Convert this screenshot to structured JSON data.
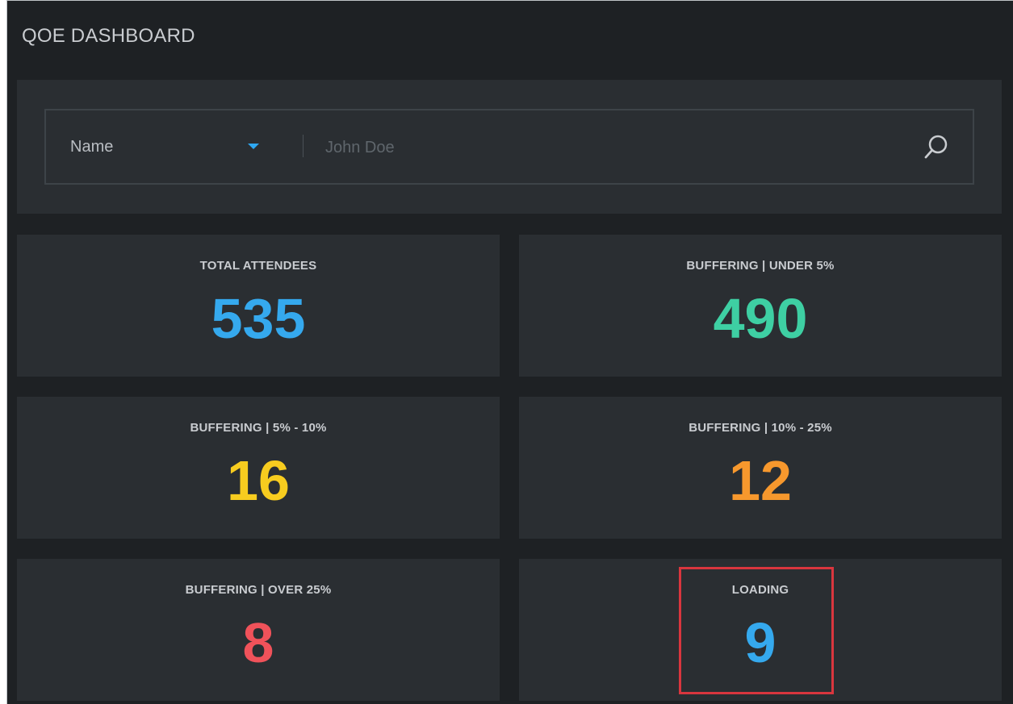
{
  "header": {
    "title": "QOE DASHBOARD"
  },
  "search": {
    "field_selected": "Name",
    "placeholder": "John Doe",
    "caret_color": "#2ea8f2"
  },
  "icons": {
    "search": "search-icon",
    "dropdown": "caret-down-icon"
  },
  "cards": [
    {
      "label": "TOTAL ATTENDEES",
      "value": "535",
      "color": "#35a9ee"
    },
    {
      "label": "BUFFERING | UNDER 5%",
      "value": "490",
      "color": "#3ecfa3"
    },
    {
      "label": "BUFFERING | 5% - 10%",
      "value": "16",
      "color": "#f7cc1f"
    },
    {
      "label": "BUFFERING | 10% - 25%",
      "value": "12",
      "color": "#f7982d"
    },
    {
      "label": "BUFFERING | OVER 25%",
      "value": "8",
      "color": "#f0525a"
    },
    {
      "label": "LOADING",
      "value": "9",
      "color": "#35a9ee"
    }
  ],
  "highlight_color": "#d9363e"
}
